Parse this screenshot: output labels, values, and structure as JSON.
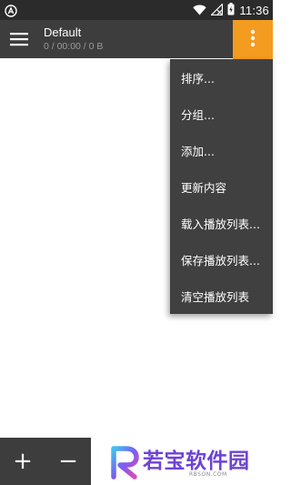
{
  "status_bar": {
    "time": "11:36",
    "icons": [
      "app-notification-icon",
      "wifi-icon",
      "signal-off-icon",
      "battery-charging-icon"
    ]
  },
  "app_bar": {
    "title": "Default",
    "subtitle": "0 / 00:00 / 0 B",
    "accent_color": "#f39c1f"
  },
  "overflow_menu": {
    "items": [
      {
        "label": "排序..."
      },
      {
        "label": "分组..."
      },
      {
        "label": "添加..."
      },
      {
        "label": "更新内容"
      },
      {
        "label": "载入播放列表..."
      },
      {
        "label": "保存播放列表..."
      },
      {
        "label": "清空播放列表"
      }
    ]
  },
  "bottom_bar": {
    "add_label": "+",
    "remove_label": "−"
  },
  "watermark": {
    "text": "若宝软件园",
    "subtext": "RBSON.COM"
  }
}
